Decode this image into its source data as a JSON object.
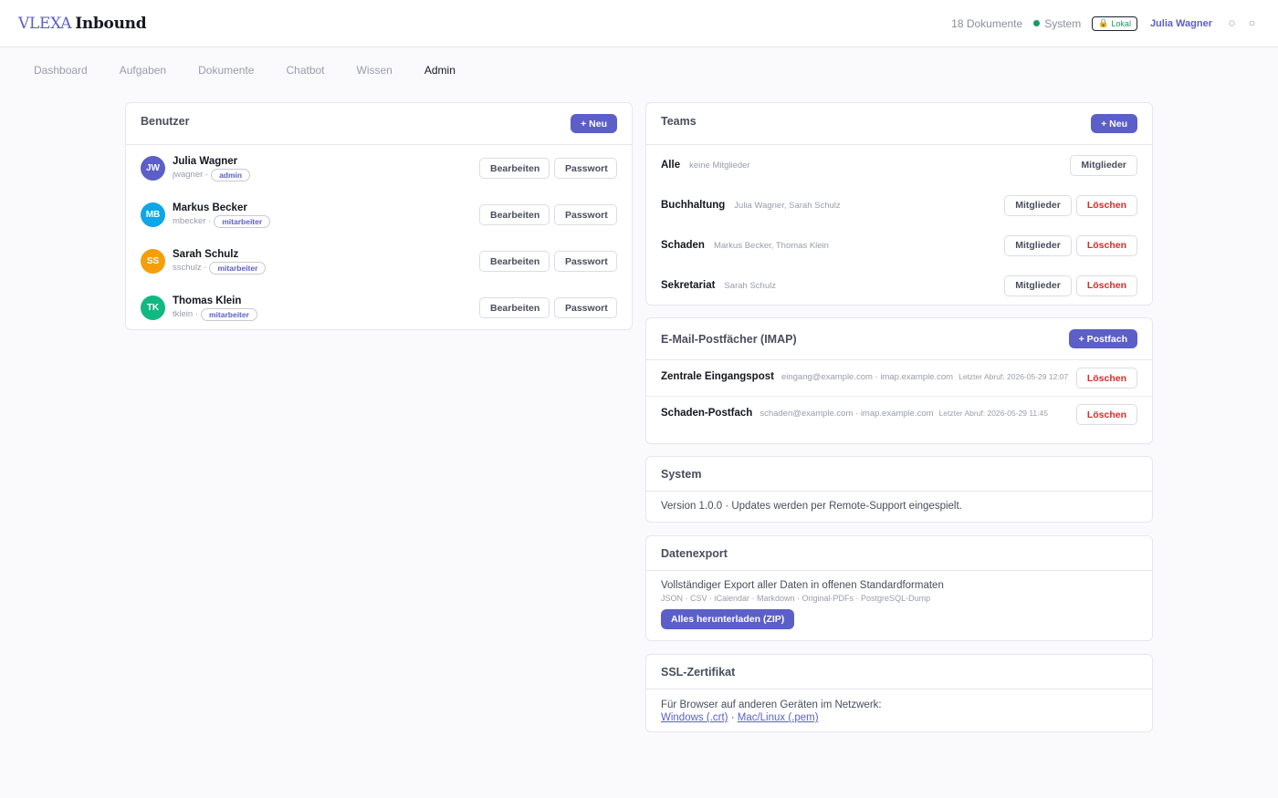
{
  "header": {
    "brand_part1": "VLEXA",
    "brand_part2": "Inbound",
    "doc_count": "18 Dokumente",
    "system_label": "System",
    "lokal_label": "Lokal",
    "user_name": "Julia Wagner",
    "icons": [
      "sun-icon",
      "settings-icon"
    ]
  },
  "nav": {
    "items": [
      "Dashboard",
      "Aufgaben",
      "Dokumente",
      "Chatbot",
      "Wissen",
      "Admin"
    ],
    "active": "Admin"
  },
  "users": {
    "title": "Benutzer",
    "new_label": "+ Neu",
    "edit_label": "Bearbeiten",
    "password_label": "Passwort",
    "list": [
      {
        "initials": "JW",
        "name": "Julia Wagner",
        "login": "jwagner ·",
        "role": "admin",
        "color": "#5b5fc7"
      },
      {
        "initials": "MB",
        "name": "Markus Becker",
        "login": "mbecker ·",
        "role": "mitarbeiter",
        "color": "#0ea5e9"
      },
      {
        "initials": "SS",
        "name": "Sarah Schulz",
        "login": "sschulz ·",
        "role": "mitarbeiter",
        "color": "#f59e0b"
      },
      {
        "initials": "TK",
        "name": "Thomas Klein",
        "login": "tklein ·",
        "role": "mitarbeiter",
        "color": "#10b981"
      }
    ]
  },
  "teams": {
    "title": "Teams",
    "new_label": "+ Neu",
    "members_label": "Mitglieder",
    "delete_label": "Löschen",
    "list": [
      {
        "name": "Alle",
        "members": "keine Mitglieder"
      },
      {
        "name": "Buchhaltung",
        "members": "Julia Wagner, Sarah Schulz"
      },
      {
        "name": "Schaden",
        "members": "Markus Becker, Thomas Klein"
      },
      {
        "name": "Sekretariat",
        "members": "Sarah Schulz"
      }
    ]
  },
  "mailboxes": {
    "title": "E-Mail-Postfächer (IMAP)",
    "new_label": "+ Postfach",
    "delete_label": "Löschen",
    "list": [
      {
        "name": "Zentrale Eingangspost",
        "info": "eingang@example.com · imap.example.com",
        "fetch": "Letzter Abruf: 2026-05-29 12:07"
      },
      {
        "name": "Schaden-Postfach",
        "info": "schaden@example.com · imap.example.com",
        "fetch": "Letzter Abruf: 2026-05-29 11:45"
      }
    ]
  },
  "system": {
    "title": "System",
    "text": "Version 1.0.0 · Updates werden per Remote-Support eingespielt."
  },
  "export": {
    "title": "Datenexport",
    "text": "Vollständiger Export aller Daten in offenen Standardformaten",
    "formats": "JSON · CSV · iCalendar · Markdown · Original-PDFs · PostgreSQL-Dump",
    "button": "Alles herunterladen (ZIP)"
  },
  "ssl": {
    "title": "SSL-Zertifikat",
    "text": "Für Browser auf anderen Geräten im Netzwerk:",
    "link_windows": "Windows (.crt)",
    "separator": "·",
    "link_mac": "Mac/Linux (.pem)"
  }
}
